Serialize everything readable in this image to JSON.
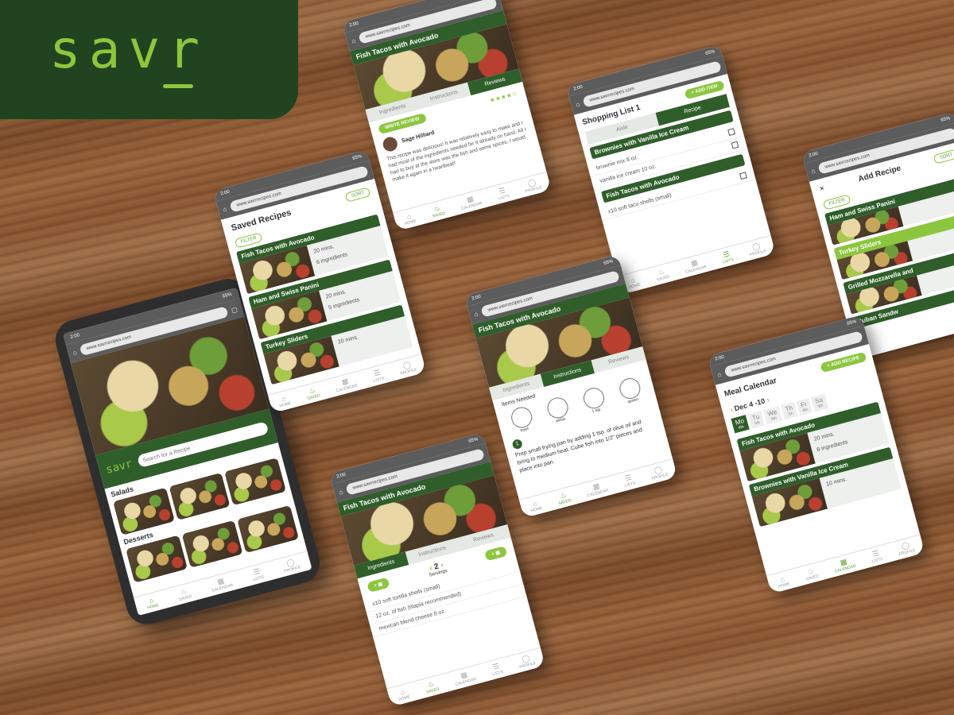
{
  "brand": {
    "name": "savr",
    "color": "#8cc63f",
    "dark": "#22431f"
  },
  "status": {
    "time": "2:00",
    "battery": "65%"
  },
  "url": "www.savrrecipes.com",
  "nav": [
    "HOME",
    "SAVED",
    "CALENDAR",
    "LISTS",
    "PROFILE"
  ],
  "main": {
    "search_placeholder": "Search for a Recipe",
    "cat1": "Salads",
    "cat2": "Desserts"
  },
  "saved": {
    "title": "Saved Recipes",
    "sort": "SORT",
    "filter": "FILTER",
    "items": [
      {
        "name": "Fish Tacos with Avocado",
        "time": "20 mins.",
        "ing": "6 ingredients"
      },
      {
        "name": "Ham and Swiss Panini",
        "time": "20 mins.",
        "ing": "5 ingredients"
      },
      {
        "name": "Turkey Sliders",
        "time": "20 mins."
      }
    ]
  },
  "reviews": {
    "title": "Fish Tacos with Avocado",
    "tabs": [
      "Ingredients",
      "Instructions",
      "Reviews"
    ],
    "write": "WRITE REVIEW",
    "stars": "★★★★☆",
    "user": "Sage Hilliard",
    "text": "This recipe was delicious! It was relatively easy to make and I had most of the ingredients needed for it already on hand. All I had to buy at the store was the fish and some spices. I would make it again in a heartbeat!"
  },
  "shopping": {
    "title": "Shopping List 1",
    "add": "+ ADD ITEM",
    "tabs": [
      "Aisle",
      "Recipe"
    ],
    "groups": [
      {
        "name": "Brownies with Vanilla Ice Cream",
        "items": [
          "brownie mix 8 oz.",
          "vanilla ice cream 10 oz."
        ]
      },
      {
        "name": "Fish Tacos with Avocado",
        "items": [
          "x10 soft taco shells (small)"
        ]
      }
    ]
  },
  "addrecipe": {
    "title": "Add Recipe",
    "sort": "SORT",
    "filter": "FILTER",
    "items": [
      "Ham and Swiss Panini",
      "Turkey Sliders",
      "Grilled Mozzarella and",
      "Cuban Sandw"
    ]
  },
  "instructions": {
    "title": "Fish Tacos with Avocado",
    "tabs": [
      "Ingredients",
      "Instructions",
      "Reviews"
    ],
    "needed": "Items Needed",
    "tools": [
      "bowl",
      "whisk",
      "1 tsp.",
      "spoon"
    ],
    "step_num": "1",
    "step": "Prep small frying pan by adding 1 tsp. of olive oil and bring to medium heat. Cube fish into 1/2\" pieces and place into pan."
  },
  "calendar": {
    "title": "Meal Calendar",
    "add": "+ ADD RECIPE",
    "range": "Dec 4 -10",
    "days": [
      {
        "d": "Mo",
        "n": "4th"
      },
      {
        "d": "Tu",
        "n": "5th"
      },
      {
        "d": "We",
        "n": "6th"
      },
      {
        "d": "Th",
        "n": "7th"
      },
      {
        "d": "Fr",
        "n": "8th"
      },
      {
        "d": "Sa",
        "n": "9th"
      }
    ],
    "items": [
      {
        "name": "Fish Tacos with Avocado",
        "time": "20 mins.",
        "ing": "8 ingredients"
      },
      {
        "name": "Brownies with Vanilla Ice Cream",
        "time": "10 mins."
      }
    ]
  },
  "ingredients": {
    "title": "Fish Tacos with Avocado",
    "tabs": [
      "Ingredients",
      "Instructions",
      "Reviews"
    ],
    "servings": "2",
    "servings_label": "Servings",
    "items": [
      "x10 soft tortilla shells (small)",
      "12 oz. of fish (tilapia recommended)",
      "mexican blend cheese 8 oz."
    ]
  }
}
